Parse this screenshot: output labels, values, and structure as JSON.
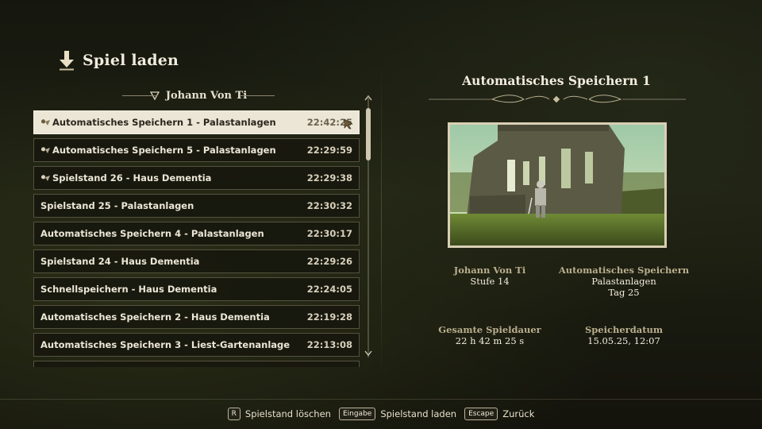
{
  "header": {
    "title": "Spiel laden",
    "icon": "down-arrow-icon"
  },
  "profile": {
    "name": "Johann Von Ti"
  },
  "saves": [
    {
      "name": "Automatisches Speichern 1 - Palastanlagen",
      "time": "22:42:25",
      "auto": true,
      "selected": true
    },
    {
      "name": "Automatisches Speichern 5 - Palastanlagen",
      "time": "22:29:59",
      "auto": true,
      "selected": false
    },
    {
      "name": "Spielstand 26 - Haus Dementia",
      "time": "22:29:38",
      "auto": true,
      "selected": false
    },
    {
      "name": "Spielstand 25 - Palastanlagen",
      "time": "22:30:32",
      "auto": false,
      "selected": false
    },
    {
      "name": "Automatisches Speichern 4 - Palastanlagen",
      "time": "22:30:17",
      "auto": false,
      "selected": false
    },
    {
      "name": "Spielstand 24 - Haus Dementia",
      "time": "22:29:26",
      "auto": false,
      "selected": false
    },
    {
      "name": "Schnellspeichern - Haus Dementia",
      "time": "22:24:05",
      "auto": false,
      "selected": false
    },
    {
      "name": "Automatisches Speichern 2 - Haus Dementia",
      "time": "22:19:28",
      "auto": false,
      "selected": false
    },
    {
      "name": "Automatisches Speichern 3 - Liest-Gartenanlage",
      "time": "22:13:08",
      "auto": false,
      "selected": false
    }
  ],
  "detail": {
    "title": "Automatisches Speichern 1",
    "character": {
      "name": "Johann Von Ti",
      "level": "Stufe 14"
    },
    "save_type": {
      "label": "Automatisches Speichern",
      "location": "Palastanlagen",
      "day": "Tag 25"
    },
    "playtime": {
      "label": "Gesamte Spieldauer",
      "value": "22 h 42 m 25 s"
    },
    "save_date": {
      "label": "Speicherdatum",
      "value": "15.05.25, 12:07"
    }
  },
  "footer": [
    {
      "key": "R",
      "label": "Spielstand löschen"
    },
    {
      "key": "Eingabe",
      "label": "Spielstand laden"
    },
    {
      "key": "Escape",
      "label": "Zurück"
    }
  ],
  "colors": {
    "accent": "#ece6d6",
    "label_gold": "#b9ae8d",
    "frame": "#d9cfb4"
  }
}
